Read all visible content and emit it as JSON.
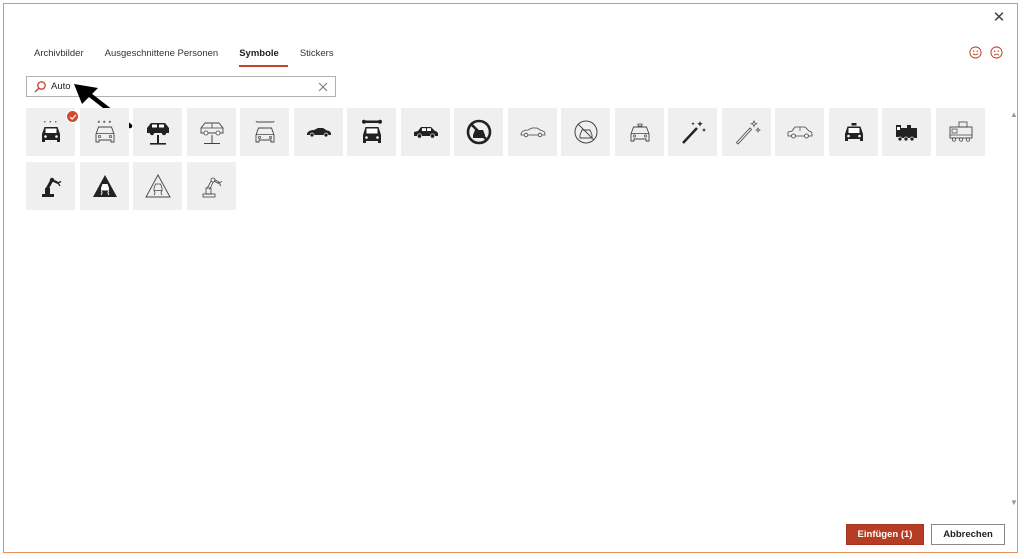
{
  "dialog": {
    "close_icon": "close-icon",
    "tabs": [
      {
        "label": "Archivbilder",
        "active": false
      },
      {
        "label": "Ausgeschnittene Personen",
        "active": false
      },
      {
        "label": "Symbole",
        "active": true
      },
      {
        "label": "Stickers",
        "active": false
      }
    ],
    "feedback": {
      "happy_icon": "smiley-happy-icon",
      "sad_icon": "smiley-sad-icon",
      "color": "#c4462a"
    },
    "search": {
      "value": "Auto",
      "icon": "search-icon",
      "clear_icon": "clear-icon"
    },
    "icons": [
      {
        "name": "car-wash-icon",
        "selected": true
      },
      {
        "name": "car-wash-outline-icon",
        "selected": false
      },
      {
        "name": "car-lift-icon",
        "selected": false
      },
      {
        "name": "car-lift-outline-icon",
        "selected": false
      },
      {
        "name": "car-repair-outline-icon",
        "selected": false
      },
      {
        "name": "sports-car-icon",
        "selected": false
      },
      {
        "name": "car-repair-icon",
        "selected": false
      },
      {
        "name": "car-side-icon",
        "selected": false
      },
      {
        "name": "no-cars-icon",
        "selected": false
      },
      {
        "name": "sports-car-outline-icon",
        "selected": false
      },
      {
        "name": "no-cars-outline-icon",
        "selected": false
      },
      {
        "name": "taxi-outline-icon",
        "selected": false
      },
      {
        "name": "magic-wand-icon",
        "selected": false
      },
      {
        "name": "magic-wand-outline-icon",
        "selected": false
      },
      {
        "name": "car-side-outline-icon",
        "selected": false
      },
      {
        "name": "taxi-icon",
        "selected": false
      },
      {
        "name": "train-icon",
        "selected": false
      },
      {
        "name": "train-outline-icon",
        "selected": false
      },
      {
        "name": "robot-arm-icon",
        "selected": false
      },
      {
        "name": "slippery-road-icon",
        "selected": false
      },
      {
        "name": "slippery-road-outline-icon",
        "selected": false
      },
      {
        "name": "robot-arm-outline-icon",
        "selected": false
      }
    ],
    "buttons": {
      "insert_label": "Einfügen (1)",
      "cancel_label": "Abbrechen"
    },
    "accent_color": "#b63c24"
  }
}
